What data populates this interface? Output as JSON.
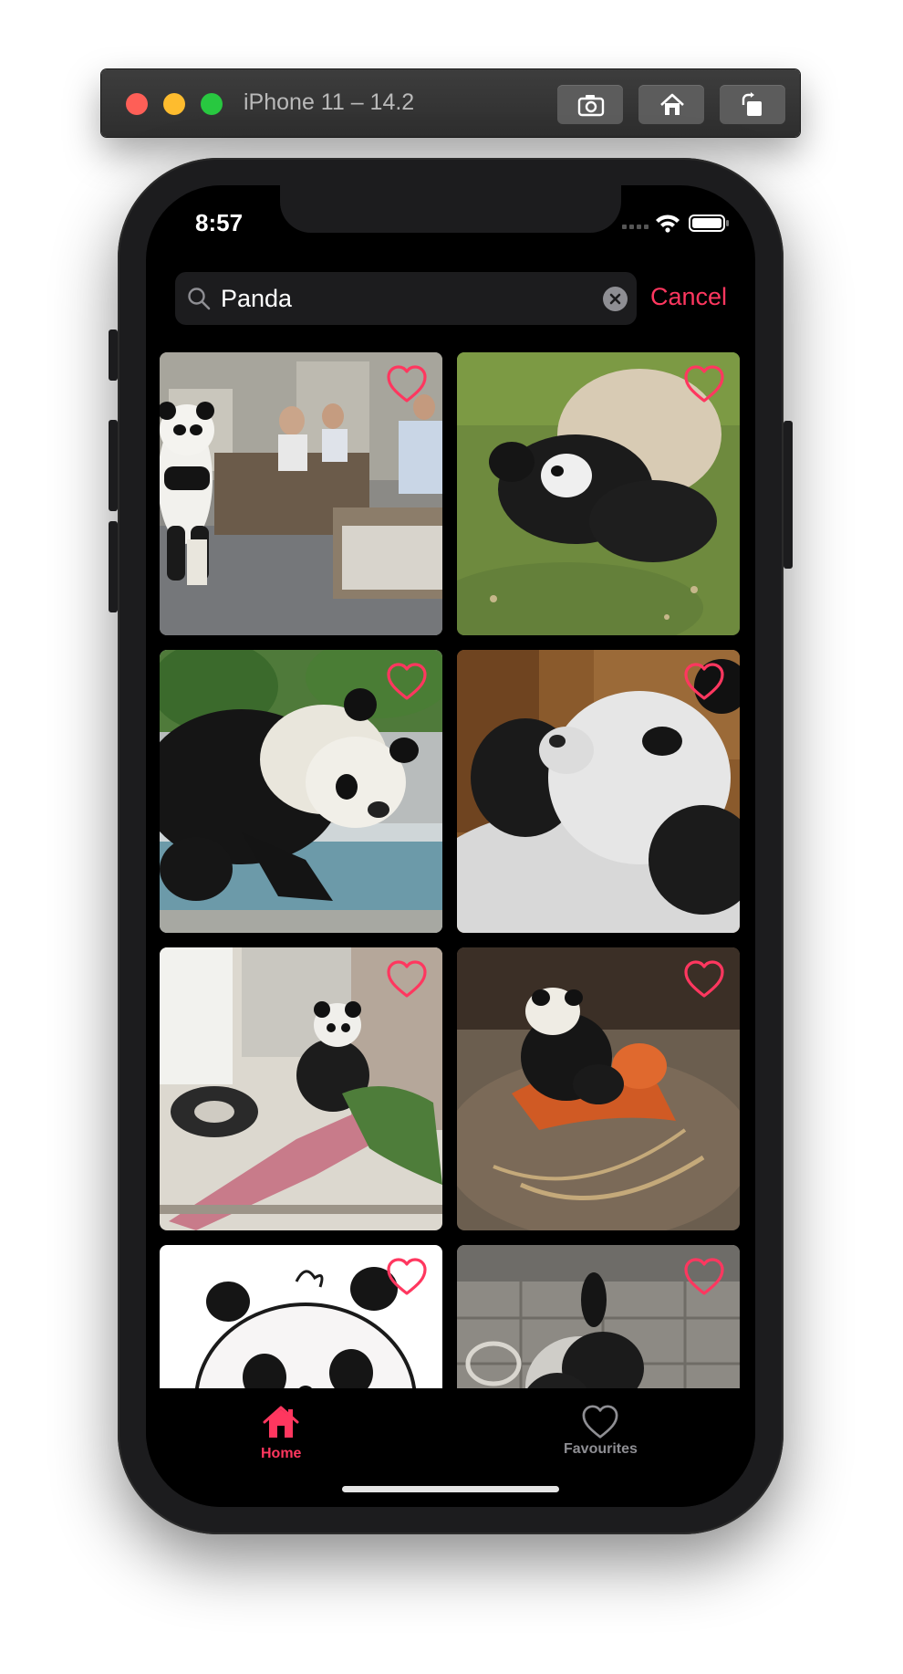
{
  "window": {
    "title": "iPhone 11 – 14.2",
    "buttons": [
      "screenshot-icon",
      "home-icon",
      "rotate-icon"
    ]
  },
  "status_bar": {
    "time": "8:57",
    "icons": [
      "signal-icon",
      "wifi-icon",
      "battery-icon"
    ]
  },
  "search": {
    "query": "Panda",
    "cancel_label": "Cancel"
  },
  "grid": {
    "tiles": [
      {
        "subject": "panda-office",
        "favourite": false
      },
      {
        "subject": "panda-rolling-grass",
        "favourite": false
      },
      {
        "subject": "panda-stretching-pool",
        "favourite": false
      },
      {
        "subject": "panda-cub-closeup",
        "favourite": false
      },
      {
        "subject": "panda-hammock",
        "favourite": false
      },
      {
        "subject": "panda-rocking-horse",
        "favourite": false
      },
      {
        "subject": "panda-cartoon",
        "favourite": false
      },
      {
        "subject": "panda-wall",
        "favourite": false
      }
    ]
  },
  "tabbar": {
    "tabs": [
      {
        "label": "Home",
        "icon": "home-icon",
        "active": true
      },
      {
        "label": "Favourites",
        "icon": "heart-icon",
        "active": false
      }
    ]
  },
  "colors": {
    "accent": "#ff375f",
    "background": "#000000",
    "inactive_tab": "#8e8e93"
  }
}
